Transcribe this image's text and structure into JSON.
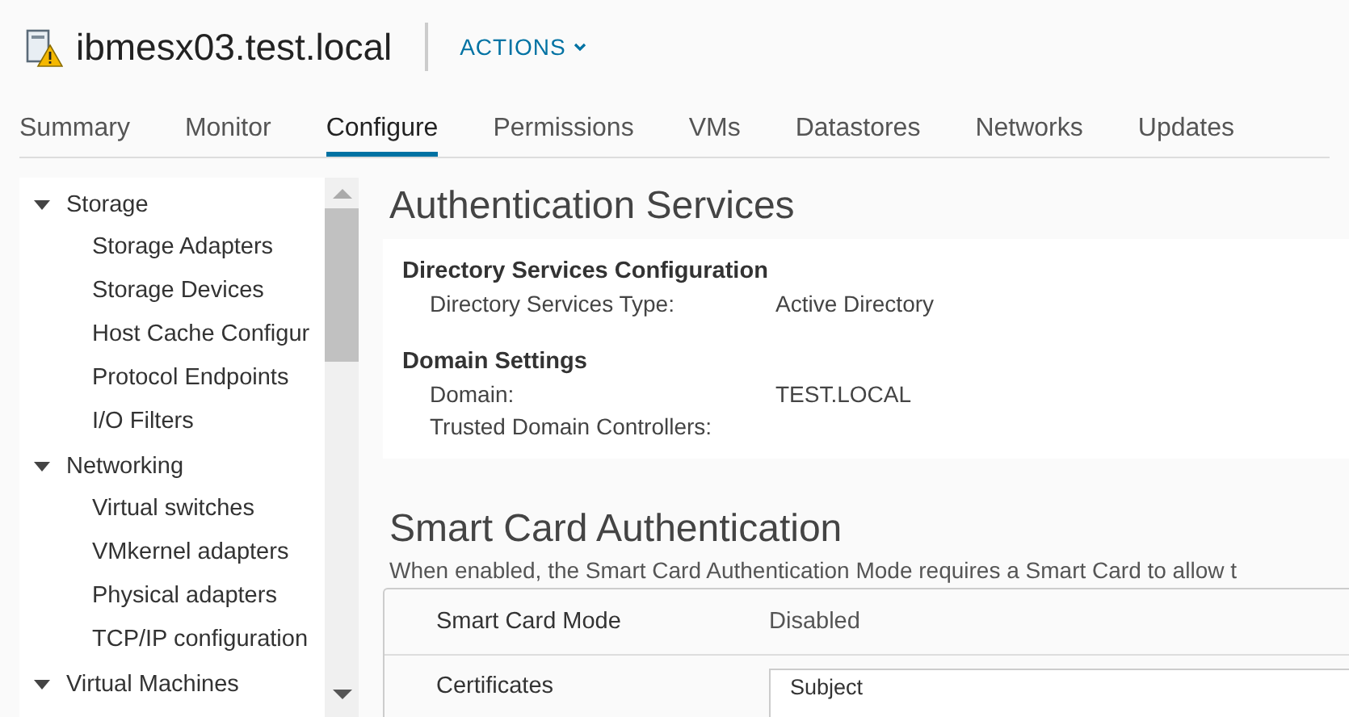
{
  "header": {
    "title": "ibmesx03.test.local",
    "actions": "ACTIONS"
  },
  "tabs": [
    {
      "label": "Summary",
      "selected": false
    },
    {
      "label": "Monitor",
      "selected": false
    },
    {
      "label": "Configure",
      "selected": true
    },
    {
      "label": "Permissions",
      "selected": false
    },
    {
      "label": "VMs",
      "selected": false
    },
    {
      "label": "Datastores",
      "selected": false
    },
    {
      "label": "Networks",
      "selected": false
    },
    {
      "label": "Updates",
      "selected": false
    }
  ],
  "sidebar": {
    "items": [
      {
        "label": "Storage",
        "expanded": true,
        "children": [
          {
            "label": "Storage Adapters"
          },
          {
            "label": "Storage Devices"
          },
          {
            "label": "Host Cache Configur"
          },
          {
            "label": "Protocol Endpoints"
          },
          {
            "label": "I/O Filters"
          }
        ]
      },
      {
        "label": "Networking",
        "expanded": true,
        "children": [
          {
            "label": "Virtual switches"
          },
          {
            "label": "VMkernel adapters"
          },
          {
            "label": "Physical adapters"
          },
          {
            "label": "TCP/IP configuration"
          }
        ]
      },
      {
        "label": "Virtual Machines",
        "expanded": true
      }
    ]
  },
  "authentication_services": {
    "title": "Authentication Services",
    "sections": [
      {
        "heading": "Directory Services Configuration",
        "rows": [
          {
            "label": "Directory Services Type:",
            "value": "Active Directory"
          }
        ]
      },
      {
        "heading": "Domain Settings",
        "rows": [
          {
            "label": "Domain:",
            "value": "TEST.LOCAL"
          },
          {
            "label": "Trusted Domain Controllers:"
          }
        ]
      }
    ]
  },
  "smart_card": {
    "title": "Smart Card Authentication",
    "description": "When enabled, the Smart Card Authentication Mode requires a Smart Card to allow t",
    "rows": [
      {
        "kind": "text",
        "label": "Smart Card Mode",
        "value": "Disabled"
      },
      {
        "kind": "table",
        "label": "Certificates",
        "column": "Subject"
      }
    ]
  }
}
